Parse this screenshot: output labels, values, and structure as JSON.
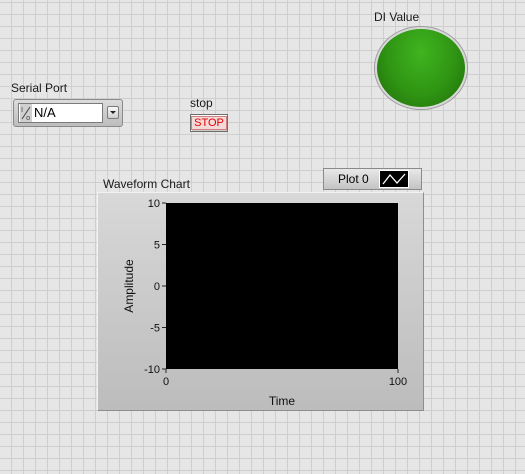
{
  "serial_port": {
    "label": "Serial Port",
    "value": "N/A"
  },
  "stop": {
    "label": "stop",
    "button_text": "STOP"
  },
  "di_value": {
    "label": "DI Value",
    "led_color": "#2f9413"
  },
  "colors": {
    "led_on": "#2f9413",
    "stop_text": "#e00000",
    "plot_bg": "#000000"
  },
  "waveform_chart": {
    "label": "Waveform Chart",
    "legend_plot_name": "Plot 0"
  },
  "chart_data": {
    "type": "line",
    "title": "Waveform Chart",
    "xlabel": "Time",
    "ylabel": "Amplitude",
    "xlim": [
      0,
      100
    ],
    "ylim": [
      -10,
      10
    ],
    "x_ticks": [
      "0",
      "100"
    ],
    "y_ticks": [
      "10",
      "5",
      "0",
      "-5",
      "-10"
    ],
    "series": [
      {
        "name": "Plot 0",
        "values": []
      }
    ],
    "grid": false,
    "legend": "top-right"
  }
}
